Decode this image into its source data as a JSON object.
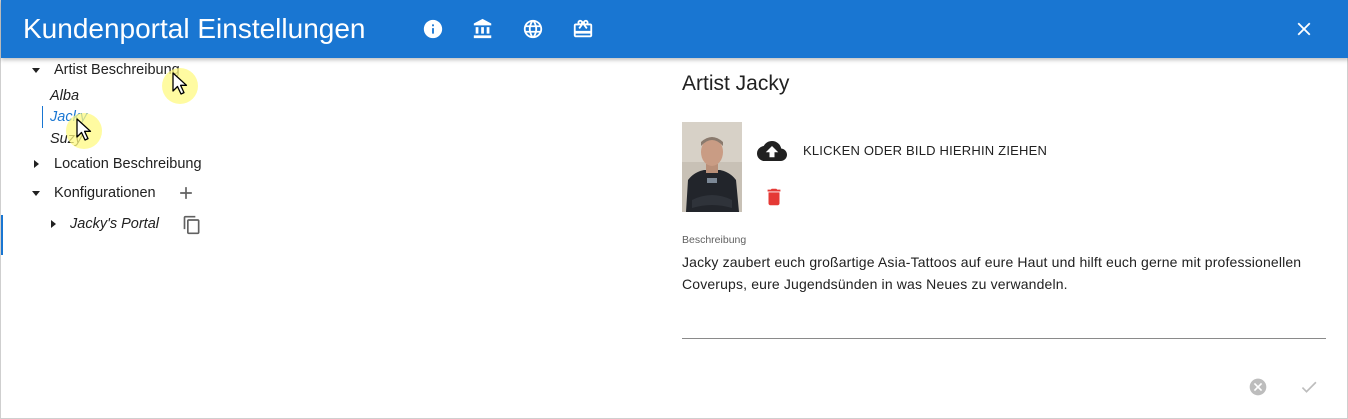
{
  "header": {
    "title": "Kundenportal Einstellungen",
    "icons": [
      "info-icon",
      "bank-icon",
      "globe-icon",
      "card-giftcard-icon"
    ],
    "close_icon": "close-icon",
    "color": "#1976d2"
  },
  "tree": {
    "artist_section": {
      "label": "Artist Beschreibung",
      "expanded": true,
      "items": [
        {
          "label": "Alba"
        },
        {
          "label": "Jacky"
        },
        {
          "label": "Suzy"
        }
      ],
      "selected": "Jacky"
    },
    "location_section": {
      "label": "Location Beschreibung",
      "expanded": false
    },
    "config_section": {
      "label": "Konfigurationen",
      "expanded": true,
      "items": [
        {
          "label": "Jacky's Portal"
        }
      ]
    }
  },
  "detail": {
    "title": "Artist Jacky",
    "upload_label": "KLICKEN ODER BILD HIERHIN ZIEHEN",
    "description_label": "Beschreibung",
    "description_text": "Jacky zaubert euch großartige Asia-Tattoos auf eure Haut und hilft euch gerne mit professionellen Coverups, eure Jugendsünden in was Neues zu verwandeln.",
    "delete_color": "#e53935"
  }
}
